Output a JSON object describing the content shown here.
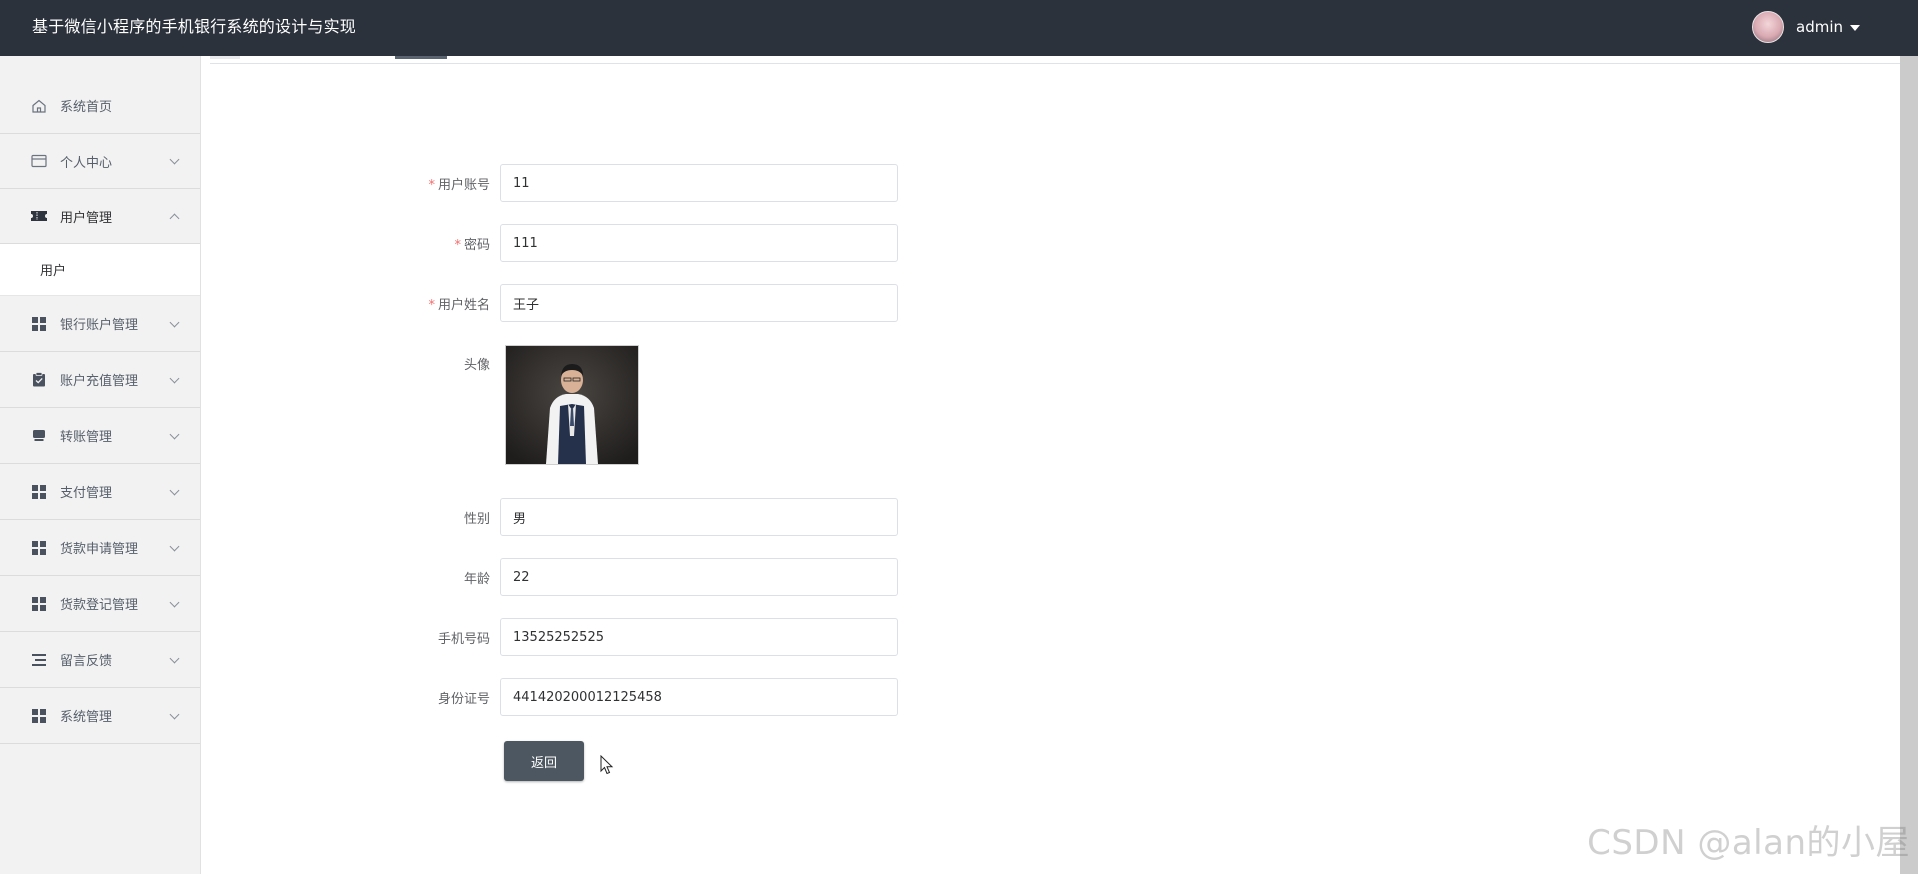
{
  "header": {
    "title": "基于微信小程序的手机银行系统的设计与实现",
    "user": {
      "name": "admin"
    }
  },
  "sidebar": {
    "items": [
      {
        "label": "系统首页",
        "icon": "home-icon"
      },
      {
        "label": "个人中心",
        "icon": "card-icon"
      },
      {
        "label": "用户管理",
        "icon": "ticket-icon",
        "expanded": true,
        "children": [
          {
            "label": "用户"
          }
        ]
      },
      {
        "label": "银行账户管理",
        "icon": "grid-icon"
      },
      {
        "label": "账户充值管理",
        "icon": "clipboard-icon"
      },
      {
        "label": "转账管理",
        "icon": "cart-icon"
      },
      {
        "label": "支付管理",
        "icon": "grid-icon"
      },
      {
        "label": "货款申请管理",
        "icon": "grid-icon"
      },
      {
        "label": "货款登记管理",
        "icon": "grid-icon"
      },
      {
        "label": "留言反馈",
        "icon": "list-icon"
      },
      {
        "label": "系统管理",
        "icon": "grid-icon"
      }
    ]
  },
  "form": {
    "account": {
      "label": "用户账号",
      "value": "11",
      "required": true
    },
    "password": {
      "label": "密码",
      "value": "111",
      "required": true
    },
    "name": {
      "label": "用户姓名",
      "value": "王子",
      "required": true
    },
    "avatar": {
      "label": "头像"
    },
    "gender": {
      "label": "性别",
      "value": "男"
    },
    "age": {
      "label": "年龄",
      "value": "22"
    },
    "phone": {
      "label": "手机号码",
      "value": "13525252525"
    },
    "id_card": {
      "label": "身份证号",
      "value": "441420200012125458"
    },
    "back_label": "返回"
  },
  "required_mark": "*",
  "watermark": "CSDN @alan的小屋",
  "colors": {
    "topbar": "#2b323c",
    "button": "#4d5761",
    "required": "#f56c6c"
  }
}
